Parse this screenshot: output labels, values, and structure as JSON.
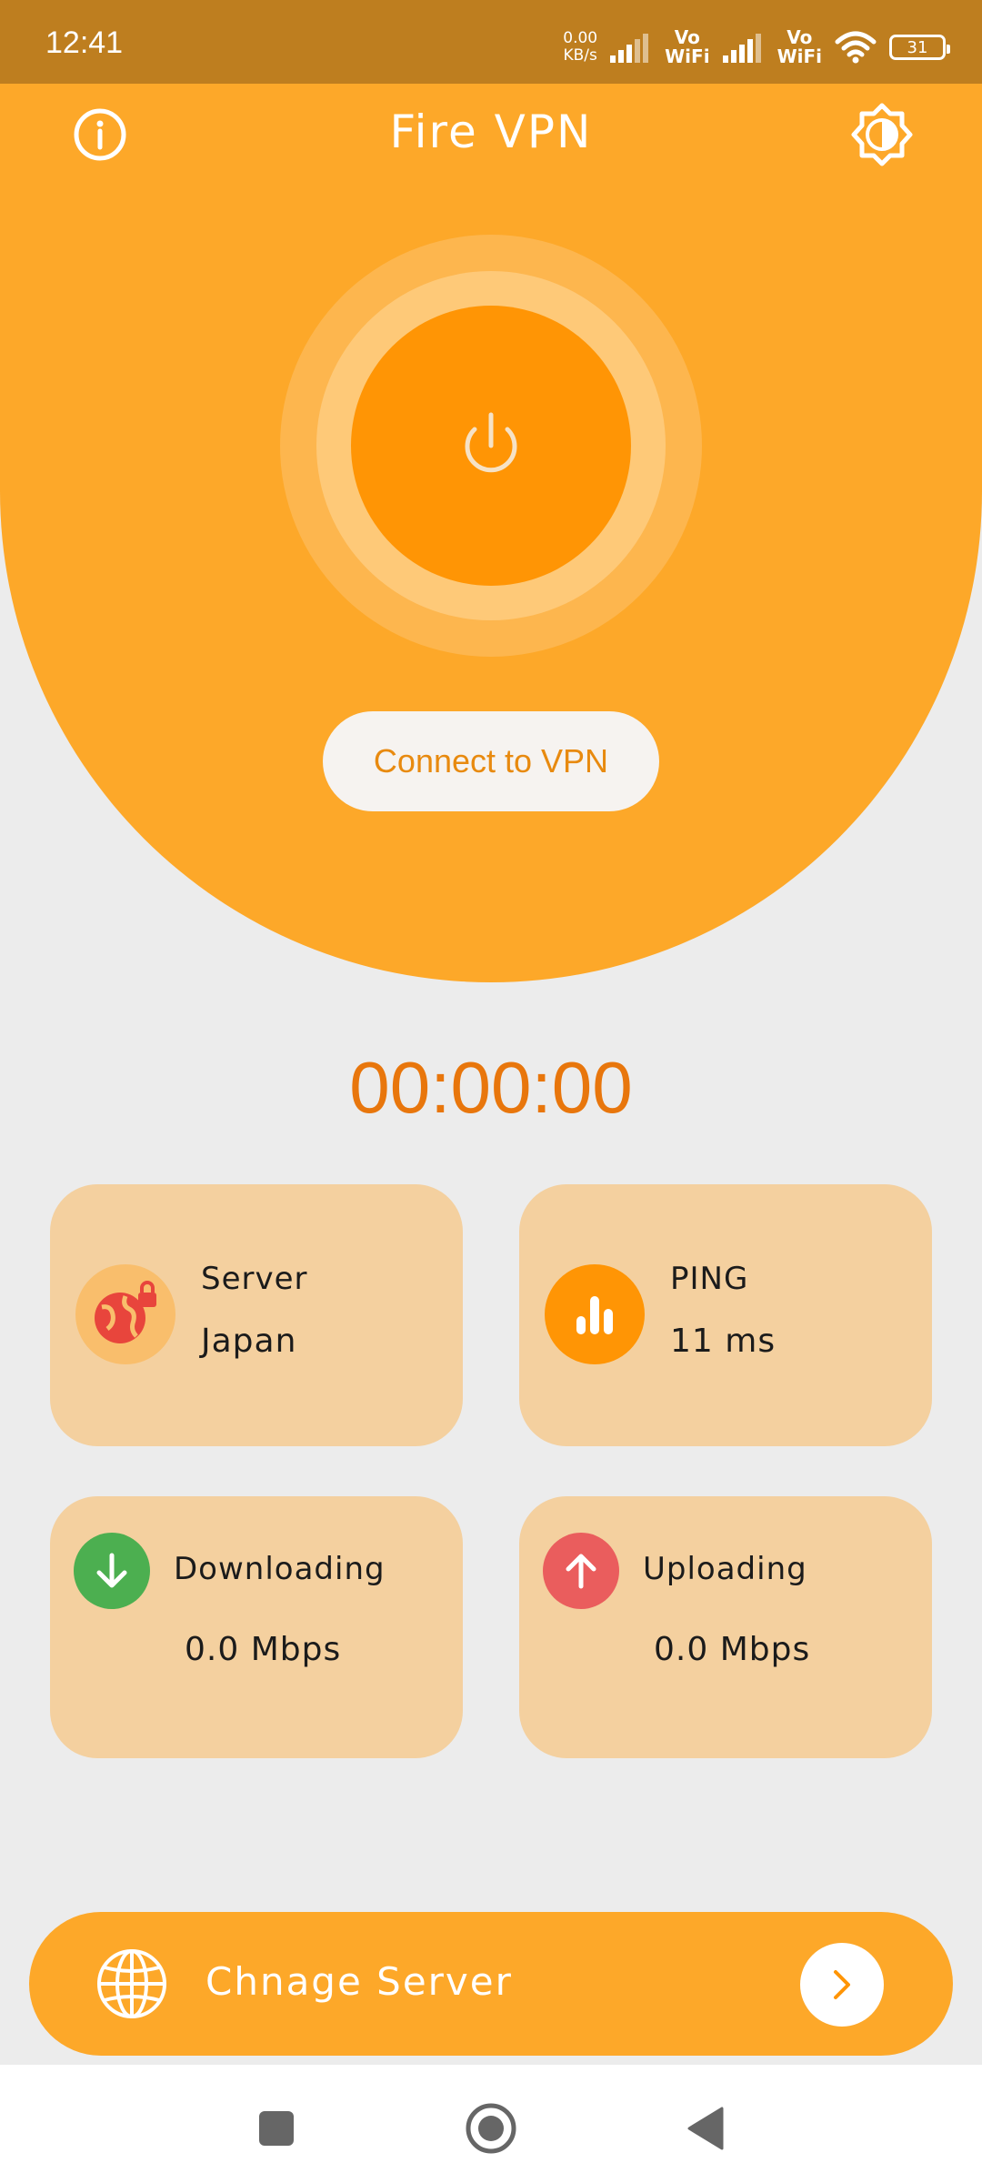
{
  "status_bar": {
    "time": "12:41",
    "net_speed_value": "0.00",
    "net_speed_unit": "KB/s",
    "sim1_label_top": "Vo",
    "sim1_label_bottom": "WiFi",
    "sim2_label_top": "Vo",
    "sim2_label_bottom": "WiFi",
    "battery": "31"
  },
  "header": {
    "title": "Fire VPN",
    "info_icon": "info-icon",
    "theme_icon": "brightness-icon"
  },
  "connect": {
    "power_icon": "power-icon",
    "button_label": "Connect to VPN"
  },
  "timer": "00:00:00",
  "stats": {
    "server": {
      "label": "Server",
      "value": "Japan",
      "icon": "globe-lock-icon"
    },
    "ping": {
      "label": "PING",
      "value": "11 ms",
      "icon": "bar-chart-icon"
    },
    "download": {
      "label": "Downloading",
      "value": "0.0 Mbps",
      "icon": "arrow-down-icon"
    },
    "upload": {
      "label": "Uploading",
      "value": "0.0 Mbps",
      "icon": "arrow-up-icon"
    }
  },
  "change_server": {
    "label": "Chnage Server",
    "icon": "globe-icon",
    "arrow_icon": "chevron-right-icon"
  },
  "nav": {
    "recents_icon": "square-icon",
    "home_icon": "circle-icon",
    "back_icon": "triangle-back-icon"
  },
  "colors": {
    "accent": "#FDA829",
    "status_bar": "#BE7E1F",
    "power_core": "#FF9505",
    "timer": "#E8760C",
    "card": "#F4D09F",
    "download_green": "#4CAF50",
    "upload_red": "#EA5D5D",
    "server_icon_red": "#E8453C"
  }
}
